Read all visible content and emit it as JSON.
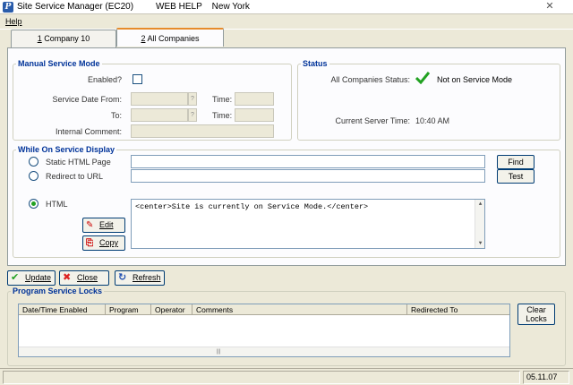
{
  "window": {
    "app_icon_letter": "P",
    "title": "Site Service Manager (EC20)         WEB HELP    New York",
    "close_glyph": "✕"
  },
  "menu": {
    "help": "Help"
  },
  "tabs": [
    {
      "mnemonic": "1",
      "label": " Company 10",
      "active": false
    },
    {
      "mnemonic": "2",
      "label": " All Companies",
      "active": true
    }
  ],
  "manual_mode": {
    "title": "Manual Service Mode",
    "enabled_label": "Enabled?",
    "enabled": false,
    "service_date_from_label": "Service Date From:",
    "to_label": "To:",
    "time_label": "Time:",
    "spin_glyph": "?",
    "internal_comment_label": "Internal Comment:"
  },
  "status": {
    "title": "Status",
    "all_companies_label": "All Companies Status:",
    "all_companies_value": "Not on Service Mode",
    "status_icon": "checkmark-icon",
    "server_time_label": "Current Server Time:",
    "server_time_value": "10:40 AM"
  },
  "display": {
    "title": "While On Service Display",
    "static_html_label": "Static HTML Page",
    "redirect_label": "Redirect to URL",
    "html_label": "HTML",
    "selected": "html",
    "find_button": "Find",
    "test_button": "Test",
    "edit_button": "Edit",
    "copy_button": "Copy",
    "html_content": "<center>Site is currently on Service Mode.</center>"
  },
  "actions": {
    "update_label": "Update",
    "close_label": "Close",
    "refresh_label": "Refresh"
  },
  "locks": {
    "title": "Program Service Locks",
    "columns": [
      "Date/Time Enabled",
      "Program",
      "Operator",
      "Comments",
      "Redirected To"
    ],
    "rows": [],
    "clear_button_line1": "Clear",
    "clear_button_line2": "Locks"
  },
  "statusbar": {
    "version": "05.11.07"
  },
  "colors": {
    "accent_tab": "#e68b2c",
    "group_title": "#003399",
    "check_green": "#21a121"
  }
}
